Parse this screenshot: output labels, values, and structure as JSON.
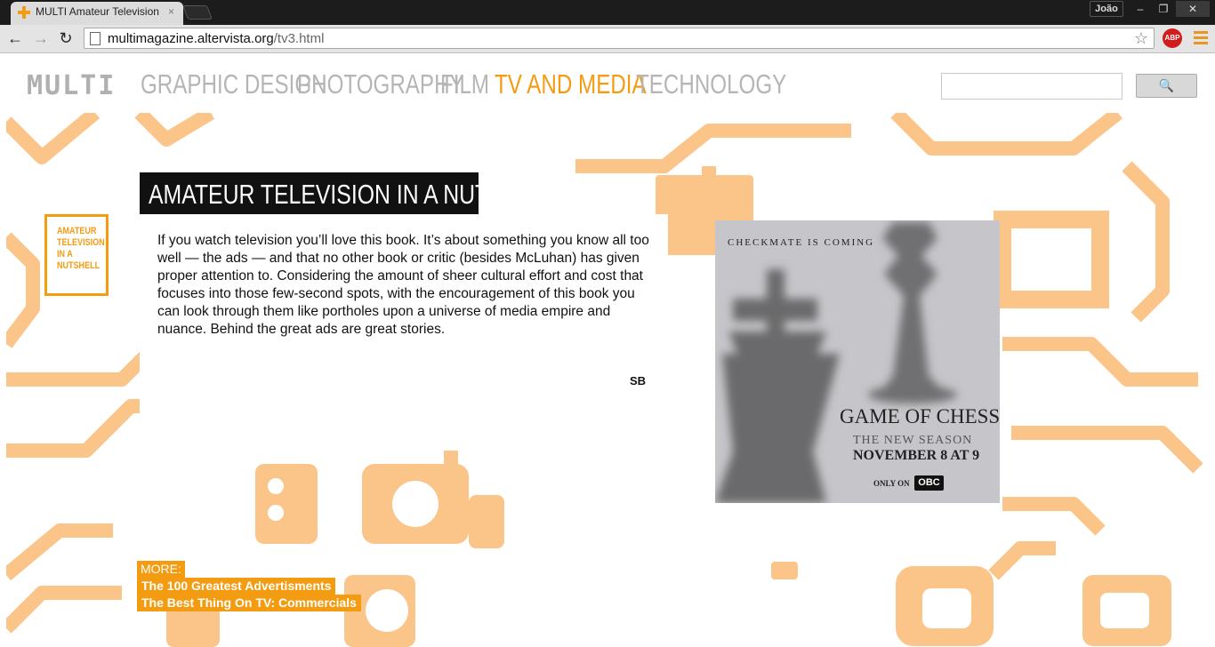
{
  "browser": {
    "tab_title": "MULTI Amateur Television",
    "tab_close": "×",
    "user_name": "João",
    "url_host": "multimagazine.altervista.org",
    "url_path": "/tv3.html",
    "abp_label": "ABP",
    "window_minimize": "–",
    "window_restore": "❐",
    "window_close": "✕",
    "back_icon": "←",
    "forward_icon": "→",
    "reload_icon": "↻",
    "star_icon": "☆"
  },
  "site": {
    "logo": "MULTI",
    "nav": [
      "GRAPHIC DESIGN",
      "PHOTOGRAPHY",
      "FILM",
      "TV AND MEDIA",
      "TECHNOLOGY"
    ],
    "active_nav": "TV AND MEDIA",
    "search_button_icon": "🔍",
    "accent_color": "#f39c12",
    "background_art_color": "#fbc58a"
  },
  "article": {
    "title": "AMATEUR TELEVISION IN A NUTSHELL",
    "side_tag": [
      "AMATEUR",
      "TELEVISION",
      "IN A",
      "NUTSHELL"
    ],
    "body": "If you watch television you’ll love this book. It’s about something you know all too well — the ads — and that no other book or critic (besides McLuhan) has given proper attention to. Considering the amount of sheer cultural effort and cost that focuses into those few-second spots, with the encouragement of this book you can look through them like portholes upon a universe of media empire and nuance. Behind the great ads are great stories.",
    "signature": "SB"
  },
  "ad": {
    "tagline": "CHECKMATE IS COMING",
    "title": "GAME OF CHESS",
    "season": "THE NEW SEASON",
    "date": "NOVEMBER 8 AT 9",
    "only_on": "ONLY ON",
    "network": "OBC"
  },
  "more": {
    "label": "MORE:",
    "links": [
      "The 100 Greatest Advertisments",
      "The Best Thing On TV: Commercials"
    ]
  }
}
